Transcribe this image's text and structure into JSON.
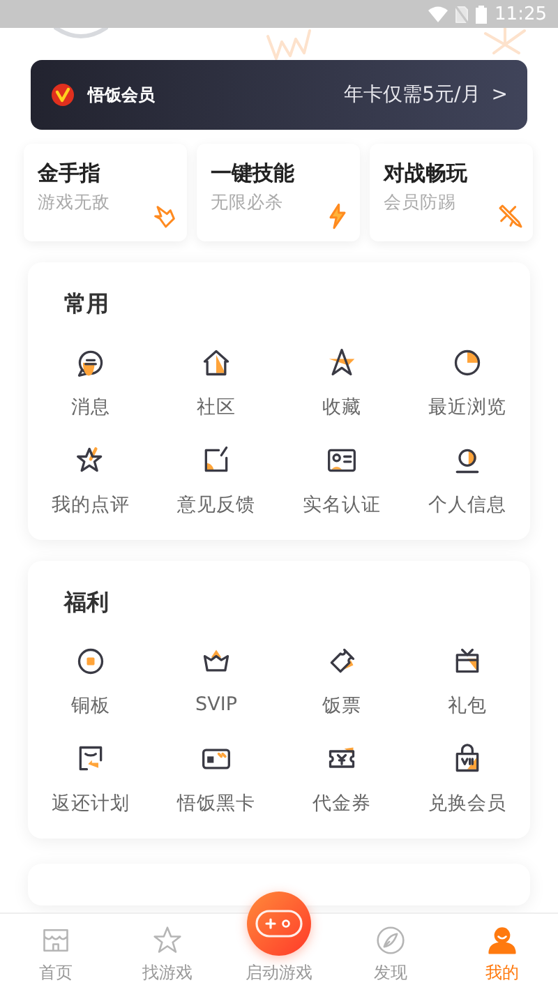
{
  "status_bar": {
    "time": "11:25"
  },
  "vip_banner": {
    "title": "悟饭会员",
    "offer": "年卡仅需5元/月",
    "arrow": ">"
  },
  "feature_cards": [
    {
      "title": "金手指",
      "subtitle": "游戏无敌"
    },
    {
      "title": "一键技能",
      "subtitle": "无限必杀"
    },
    {
      "title": "对战畅玩",
      "subtitle": "会员防踢"
    }
  ],
  "sections": [
    {
      "title": "常用",
      "items": [
        {
          "label": "消息"
        },
        {
          "label": "社区"
        },
        {
          "label": "收藏"
        },
        {
          "label": "最近浏览"
        },
        {
          "label": "我的点评"
        },
        {
          "label": "意见反馈"
        },
        {
          "label": "实名认证"
        },
        {
          "label": "个人信息"
        }
      ]
    },
    {
      "title": "福利",
      "items": [
        {
          "label": "铜板"
        },
        {
          "label": "SVIP"
        },
        {
          "label": "饭票"
        },
        {
          "label": "礼包"
        },
        {
          "label": "返还计划"
        },
        {
          "label": "悟饭黑卡"
        },
        {
          "label": "代金券"
        },
        {
          "label": "兑换会员"
        }
      ]
    }
  ],
  "tab_bar": [
    {
      "label": "首页",
      "selected": false
    },
    {
      "label": "找游戏",
      "selected": false
    },
    {
      "label": "启动游戏",
      "selected": false,
      "kind": "center"
    },
    {
      "label": "发现",
      "selected": false
    },
    {
      "label": "我的",
      "selected": true
    }
  ]
}
